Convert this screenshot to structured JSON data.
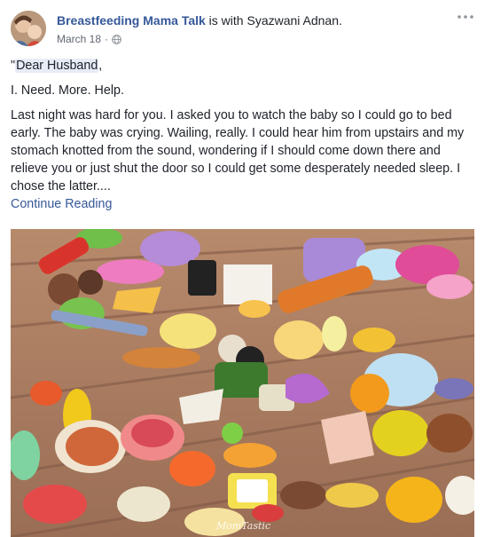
{
  "post": {
    "author": "Breastfeeding Mama Talk",
    "with_text": " is with ",
    "tagged_person": "Syazwani Adnan.",
    "date": "March 18",
    "dot": "·",
    "privacy_icon": "globe-icon",
    "more_icon": "more-options-icon",
    "greeting_prefix": "\"",
    "greeting": "Dear Husband",
    "greeting_suffix": ",",
    "line2": "I. Need. More. Help.",
    "body": "Last night was hard for you. I asked you to watch the baby so I could go to bed early. The baby was crying. Wailing, really. I could hear him from upstairs and my stomach knotted from the sound, wondering if I should come down there and relieve you or just shut the door so I could get some desperately needed sleep. I chose the latter....",
    "continue_link": "Continue Reading"
  },
  "photo": {
    "watermark": "MomTastic"
  },
  "colors": {
    "link": "#365899",
    "text": "#1d2129",
    "meta": "#616770",
    "highlight": "#e7ecf5"
  }
}
